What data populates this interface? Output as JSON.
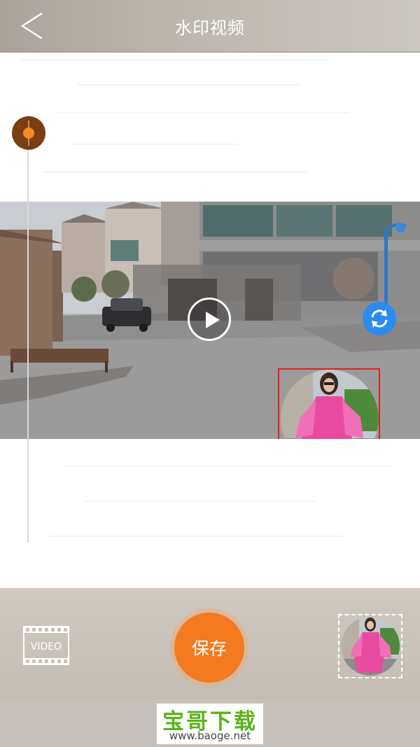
{
  "header": {
    "title": "水印视频",
    "back_icon": "chevron-left-icon"
  },
  "timeline": {
    "handle_icon": "slider-handle-icon",
    "handle_color": "#7a3e12",
    "dot_color": "#f58a1f"
  },
  "preview": {
    "play_icon": "play-icon",
    "rotate_icon": "rotate-icon",
    "overlay_border_color": "#e02020",
    "rotate_color": "#2a8cf0"
  },
  "toolbar": {
    "video_label": "VIDEO",
    "save_label": "保存",
    "save_color": "#f47a1f",
    "thumbnail_icon": "watermark-thumbnail-icon"
  },
  "footer": {
    "brand_name": "宝哥下载",
    "brand_url": "www.baoge.net",
    "brand_color": "#59b51a"
  }
}
